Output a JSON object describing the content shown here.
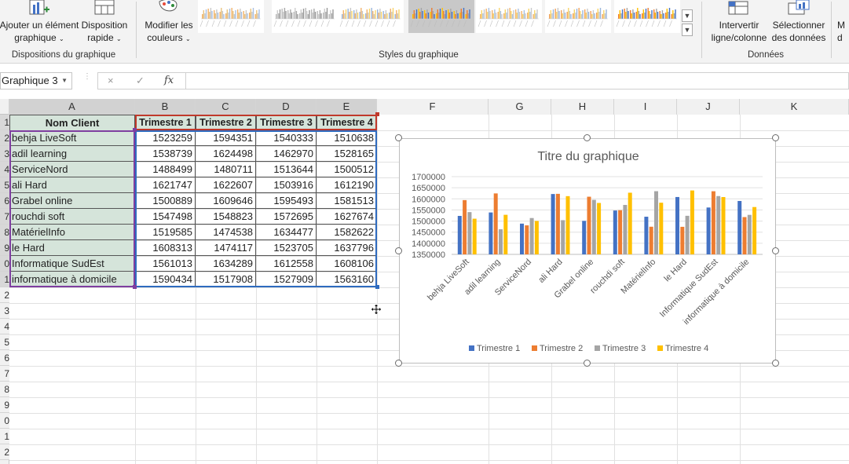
{
  "ribbon": {
    "add_element": [
      "Ajouter un élément",
      "graphique"
    ],
    "quick_layout": [
      "Disposition",
      "rapide"
    ],
    "change_colors": [
      "Modifier les",
      "couleurs"
    ],
    "switch_row_col": [
      "Intervertir",
      "ligne/colonne"
    ],
    "select_data": [
      "Sélectionner",
      "des données"
    ],
    "partial_right": [
      "M",
      "d"
    ],
    "groups": {
      "layouts": "Dispositions du graphique",
      "styles": "Styles du graphique",
      "data": "Données"
    }
  },
  "formula_bar": {
    "name_box": "Graphique 3",
    "fx": "fx",
    "cancel": "×",
    "enter": "✓",
    "formula": ""
  },
  "columns": [
    "A",
    "B",
    "C",
    "D",
    "E",
    "F",
    "G",
    "H",
    "I",
    "J",
    "K"
  ],
  "rows": [
    "1",
    "2",
    "3",
    "4",
    "5",
    "6",
    "7",
    "8",
    "9",
    "0",
    "1",
    "2",
    "3",
    "4",
    "5",
    "6",
    "7",
    "8",
    "9",
    "0",
    "1",
    "2"
  ],
  "table": {
    "header": [
      "Nom Client",
      "Trimestre 1",
      "Trimestre 2",
      "Trimestre 3",
      "Trimestre 4"
    ],
    "rows": [
      [
        "behja LiveSoft",
        "1523259",
        "1594351",
        "1540333",
        "1510638"
      ],
      [
        "adil learning",
        "1538739",
        "1624498",
        "1462970",
        "1528165"
      ],
      [
        "ServiceNord",
        "1488499",
        "1480711",
        "1513644",
        "1500512"
      ],
      [
        "ali Hard",
        "1621747",
        "1622607",
        "1503916",
        "1612190"
      ],
      [
        "Grabel online",
        "1500889",
        "1609646",
        "1595493",
        "1581513"
      ],
      [
        "rouchdi soft",
        "1547498",
        "1548823",
        "1572695",
        "1627674"
      ],
      [
        "MatérielInfo",
        "1519585",
        "1474538",
        "1634477",
        "1582622"
      ],
      [
        "le Hard",
        "1608313",
        "1474117",
        "1523705",
        "1637796"
      ],
      [
        "Informatique SudEst",
        "1561013",
        "1634289",
        "1612558",
        "1608106"
      ],
      [
        "informatique à domicile",
        "1590434",
        "1517908",
        "1527909",
        "1563160"
      ]
    ]
  },
  "chart_data": {
    "type": "bar",
    "title": "Titre du graphique",
    "categories": [
      "behja LiveSoft",
      "adil learning",
      "ServiceNord",
      "ali Hard",
      "Grabel online",
      "rouchdi soft",
      "MatérielInfo",
      "le Hard",
      "Informatique SudEst",
      "informatique à domicile"
    ],
    "series": [
      {
        "name": "Trimestre 1",
        "color": "#4472c4",
        "values": [
          1523259,
          1538739,
          1488499,
          1621747,
          1500889,
          1547498,
          1519585,
          1608313,
          1561013,
          1590434
        ]
      },
      {
        "name": "Trimestre 2",
        "color": "#ed7d31",
        "values": [
          1594351,
          1624498,
          1480711,
          1622607,
          1609646,
          1548823,
          1474538,
          1474117,
          1634289,
          1517908
        ]
      },
      {
        "name": "Trimestre 3",
        "color": "#a5a5a5",
        "values": [
          1540333,
          1462970,
          1513644,
          1503916,
          1595493,
          1572695,
          1634477,
          1523705,
          1612558,
          1527909
        ]
      },
      {
        "name": "Trimestre 4",
        "color": "#ffc000",
        "values": [
          1510638,
          1528165,
          1500512,
          1612190,
          1581513,
          1627674,
          1582622,
          1637796,
          1608106,
          1563160
        ]
      }
    ],
    "ylim": [
      1350000,
      1700000
    ],
    "yticks": [
      "1350000",
      "1400000",
      "1450000",
      "1500000",
      "1550000",
      "1600000",
      "1650000",
      "1700000"
    ],
    "legend": "bottom",
    "grid": true
  }
}
